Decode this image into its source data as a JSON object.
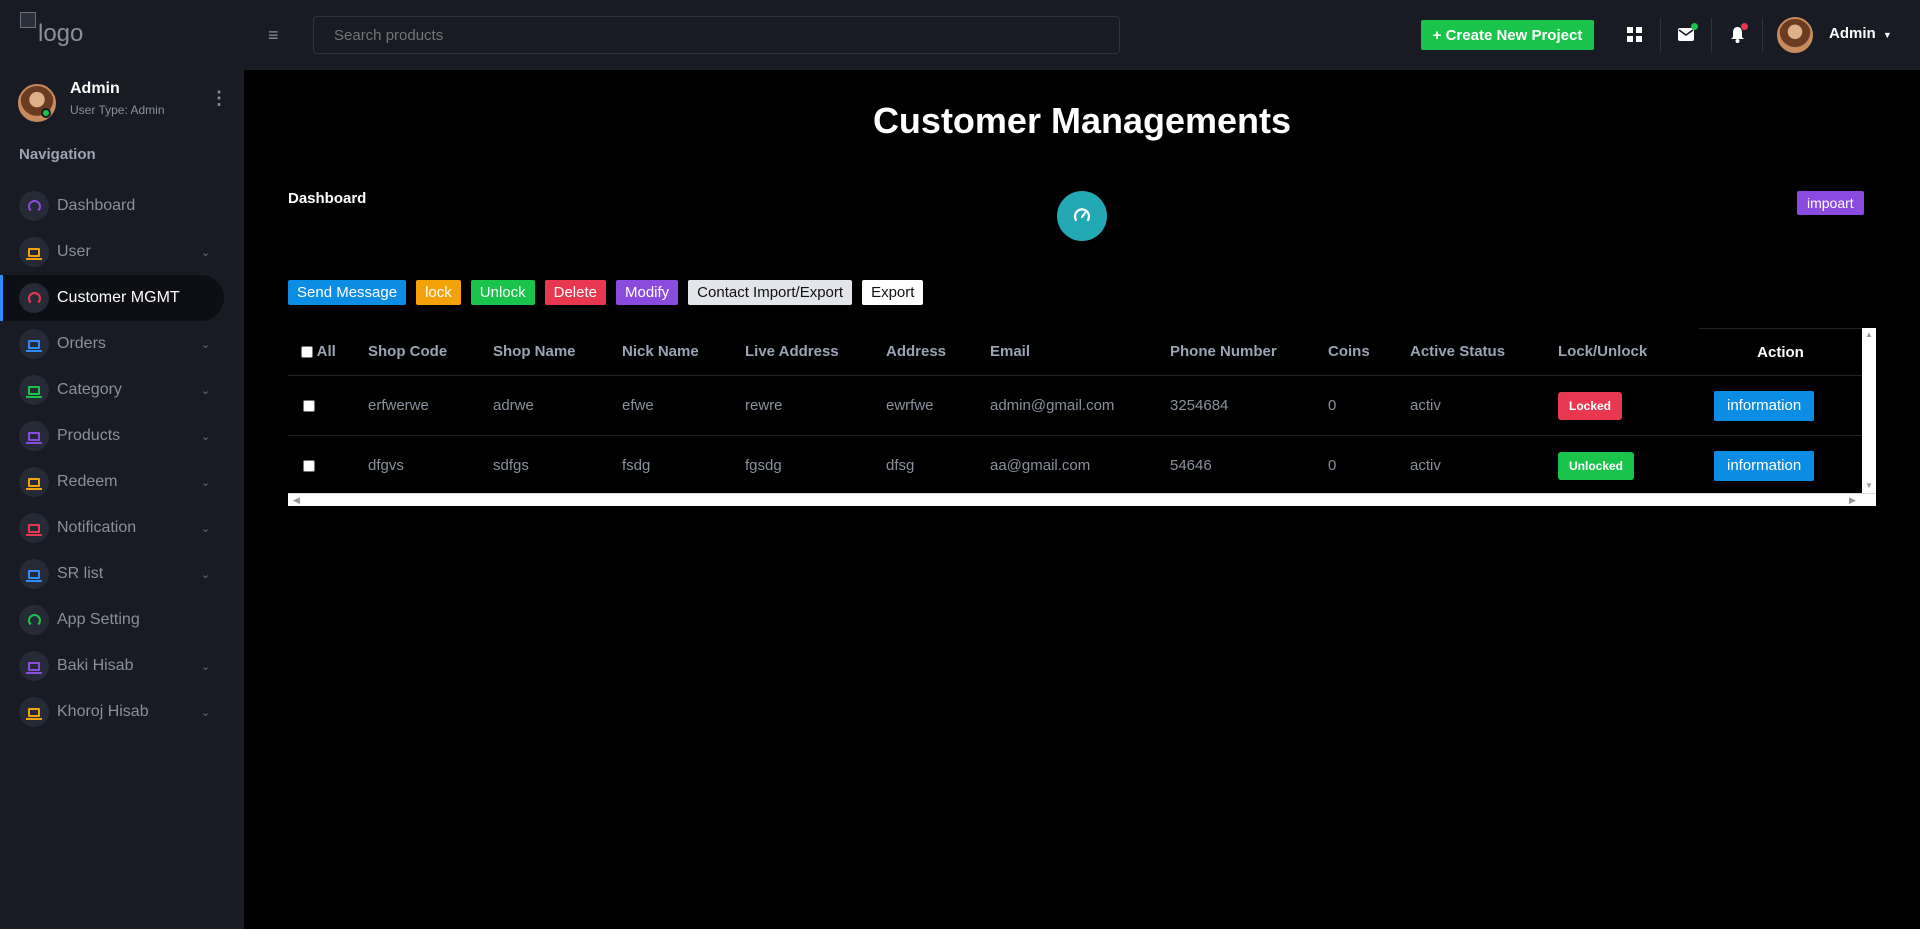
{
  "header": {
    "logo_alt": "logo",
    "search_placeholder": "Search products",
    "create_label": "+ Create New Project",
    "user_name": "Admin"
  },
  "sidebar": {
    "user_name": "Admin",
    "user_type": "User Type: Admin",
    "nav_title": "Navigation",
    "items": [
      {
        "label": "Dashboard",
        "icon": "gauge-icon",
        "color": "#8a4be0",
        "expandable": false,
        "active": false
      },
      {
        "label": "User",
        "icon": "laptop-icon",
        "color": "#f4a20a",
        "expandable": true,
        "active": false
      },
      {
        "label": "Customer MGMT",
        "icon": "gauge-icon",
        "color": "#e8384f",
        "expandable": false,
        "active": true
      },
      {
        "label": "Orders",
        "icon": "laptop-icon",
        "color": "#2f8cff",
        "expandable": true,
        "active": false
      },
      {
        "label": "Category",
        "icon": "laptop-icon",
        "color": "#1ac44b",
        "expandable": true,
        "active": false
      },
      {
        "label": "Products",
        "icon": "laptop-icon",
        "color": "#8a4be0",
        "expandable": true,
        "active": false
      },
      {
        "label": "Redeem",
        "icon": "laptop-icon",
        "color": "#f4a20a",
        "expandable": true,
        "active": false
      },
      {
        "label": "Notification",
        "icon": "laptop-icon",
        "color": "#e8384f",
        "expandable": true,
        "active": false
      },
      {
        "label": "SR list",
        "icon": "laptop-icon",
        "color": "#2f8cff",
        "expandable": true,
        "active": false
      },
      {
        "label": "App Setting",
        "icon": "gauge-icon",
        "color": "#1ac44b",
        "expandable": false,
        "active": false
      },
      {
        "label": "Baki Hisab",
        "icon": "laptop-icon",
        "color": "#8a4be0",
        "expandable": true,
        "active": false
      },
      {
        "label": "Khoroj Hisab",
        "icon": "laptop-icon",
        "color": "#f4a20a",
        "expandable": true,
        "active": false
      }
    ]
  },
  "main": {
    "title": "Customer Managements",
    "breadcrumb": "Dashboard",
    "impoart_label": "impoart",
    "actions": [
      {
        "label": "Send Message",
        "style": "b-blue",
        "name": "send-message-button"
      },
      {
        "label": "lock",
        "style": "b-orange",
        "name": "lock-button"
      },
      {
        "label": "Unlock",
        "style": "b-green",
        "name": "unlock-button"
      },
      {
        "label": "Delete",
        "style": "b-red",
        "name": "delete-button"
      },
      {
        "label": "Modify",
        "style": "b-purple",
        "name": "modify-button"
      },
      {
        "label": "Contact Import/Export",
        "style": "b-light",
        "name": "contact-import-export-button"
      },
      {
        "label": "Export",
        "style": "b-white",
        "name": "export-button"
      }
    ],
    "table": {
      "all_label": "All",
      "columns": [
        "Shop Code",
        "Shop Name",
        "Nick Name",
        "Live Address",
        "Address",
        "Email",
        "Phone Number",
        "Coins",
        "Active Status",
        "Lock/Unlock",
        "Action"
      ],
      "rows": [
        {
          "shop_code": "erfwerwe",
          "shop_name": "adrwe",
          "nick_name": "efwe",
          "live_address": "rewre",
          "address": "ewrfwe",
          "email": "admin@gmail.com",
          "phone": "3254684",
          "coins": "0",
          "status": "activ",
          "lock": "Locked",
          "lock_state": "locked",
          "action": "information"
        },
        {
          "shop_code": "dfgvs",
          "shop_name": "sdfgs",
          "nick_name": "fsdg",
          "live_address": "fgsdg",
          "address": "dfsg",
          "email": "aa@gmail.com",
          "phone": "54646",
          "coins": "0",
          "status": "activ",
          "lock": "Unlocked",
          "lock_state": "unlocked",
          "action": "information"
        }
      ]
    }
  }
}
